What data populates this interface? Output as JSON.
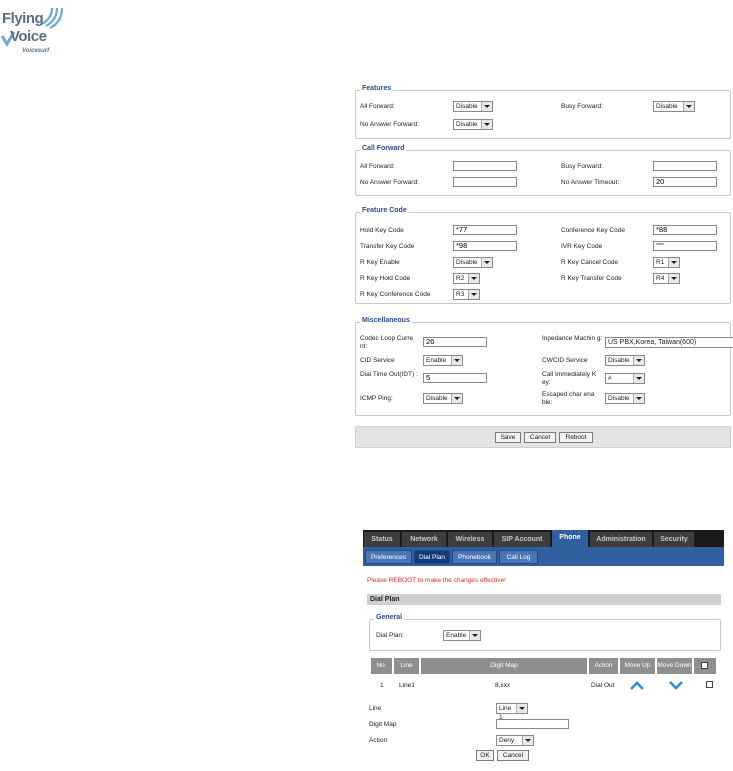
{
  "brand": {
    "line1": "Flying",
    "line2": "Voice",
    "tagline": "Voicesurf"
  },
  "features": {
    "title": "Features",
    "all_forward_label": "All Forward:",
    "all_forward_value": "Disable",
    "busy_forward_label": "Busy Forward:",
    "busy_forward_value": "Disable",
    "no_answer_forward_label": "No Answer Forward:",
    "no_answer_forward_value": "Disable"
  },
  "call_forward": {
    "title": "Call Forward",
    "all_forward_label": "All Forward:",
    "all_forward_value": "",
    "busy_forward_label": "Busy Forward:",
    "busy_forward_value": "",
    "no_answer_forward_label": "No Answer Forward:",
    "no_answer_forward_value": "",
    "no_answer_timeout_label": "No Answer Timeout:",
    "no_answer_timeout_value": "20"
  },
  "feature_code": {
    "title": "Feature Code",
    "hold_key_label": "Hold Key Code",
    "hold_key_value": "*77",
    "conference_key_label": "Conference Key Code",
    "conference_key_value": "*88",
    "transfer_key_label": "Transfer Key Code",
    "transfer_key_value": "*98",
    "ivr_key_label": "IVR Key Code",
    "ivr_key_value": "****",
    "r_key_enable_label": "R Key Enable",
    "r_key_enable_value": "Disable",
    "r_key_cancel_label": "R Key Cancel Code",
    "r_key_cancel_value": "R1",
    "r_key_hold_label": "R Key Hold Code",
    "r_key_hold_value": "R2",
    "r_key_transfer_label": "R Key Transfer Code",
    "r_key_transfer_value": "R4",
    "r_key_conference_label": "R Key Conference Code",
    "r_key_conference_value": "R3"
  },
  "misc": {
    "title": "Miscellaneous",
    "codec_loop_label": "Codec Loop Curre nt:",
    "codec_loop_value": "26",
    "impedance_label": "Inpedance Machin g:",
    "impedance_value": "US PBX,Korea, Taiwan(600)",
    "cid_service_label": "CID Service",
    "cid_service_value": "Enable",
    "cwcid_service_label": "CWCID Service",
    "cwcid_service_value": "Disable",
    "dial_timeout_label": "Dial Time Out(IDT) :",
    "dial_timeout_value": "5",
    "call_immediately_label": "Call Immediately K ey:",
    "call_immediately_value": "#",
    "icmp_ping_label": "ICMP Ping:",
    "icmp_ping_value": "Disable",
    "escaped_char_label": "Escaped char ena ble:",
    "escaped_char_value": "Disable"
  },
  "buttons": {
    "save": "Save",
    "cancel": "Cancel",
    "reboot": "Reboot"
  },
  "dialplan": {
    "tabs": [
      "Status",
      "Network",
      "Wireless",
      "SIP Account",
      "Phone",
      "Administration",
      "Security"
    ],
    "subtabs": [
      "Preferences",
      "Dial Plan",
      "Phonebook",
      "Call Log"
    ],
    "warning": "Please REBOOT to make the changes effective!",
    "section_title": "Dial Plan",
    "general_title": "General",
    "dial_plan_label": "Dial Plan:",
    "dial_plan_value": "Enable",
    "columns": [
      "No.",
      "Line",
      "Digit Map",
      "Action",
      "Move Up",
      "Move Down"
    ],
    "row": {
      "no": "1",
      "line": "Line1",
      "digit_map": "8,xxx",
      "action": "Dial Out"
    },
    "line_label": "Line",
    "line_value": "Line 1",
    "digit_map_label": "Digit Map",
    "digit_map_value": "",
    "action_label": "Action",
    "action_value": "Deny",
    "ok_label": "OK",
    "cancel_label": "Cancel"
  }
}
